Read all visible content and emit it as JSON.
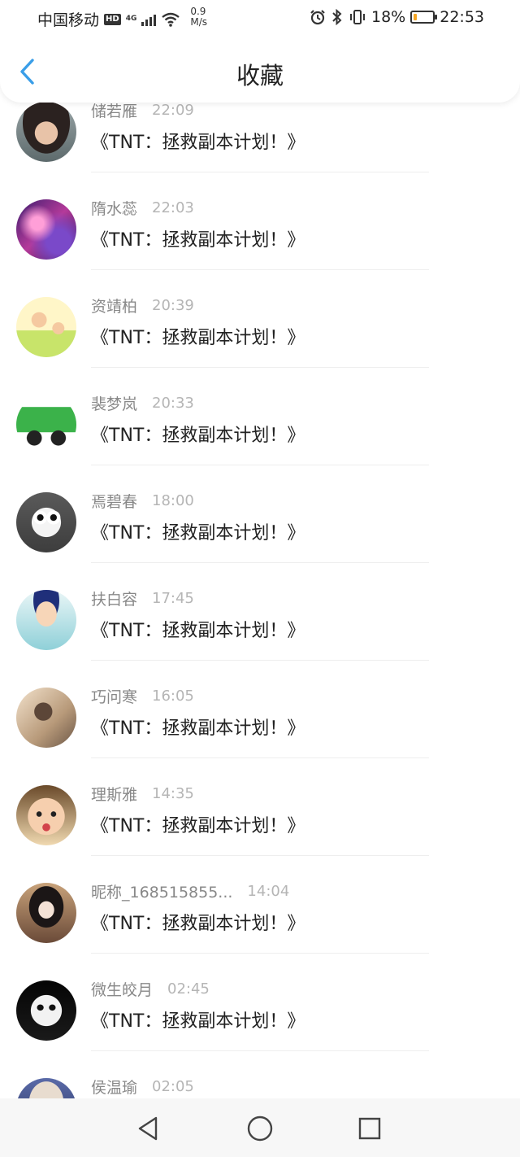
{
  "status_bar": {
    "carrier": "中国移动",
    "hd": "HD",
    "net_type": "4G",
    "speed_value": "0.9",
    "speed_unit": "M/s",
    "battery_percent": "18%",
    "battery_level": 0.18,
    "time": "22:53",
    "icons": [
      "alarm-icon",
      "bluetooth-icon",
      "vibrate-icon",
      "battery-icon"
    ]
  },
  "header": {
    "title": "收藏",
    "back_icon": "chevron-left-icon",
    "accent_color": "#3a9ee8"
  },
  "favorites": [
    {
      "name": "储若雁",
      "time": "22:09",
      "title": "《TNT：拯救副本计划！》",
      "avatar": "woman-portrait"
    },
    {
      "name": "隋水蕊",
      "time": "22:03",
      "title": "《TNT：拯救副本计划！》",
      "avatar": "purple-galaxy"
    },
    {
      "name": "资靖柏",
      "time": "20:39",
      "title": "《TNT：拯救副本计划！》",
      "avatar": "cartoon-kids"
    },
    {
      "name": "裴梦岚",
      "time": "20:33",
      "title": "《TNT：拯救副本计划！》",
      "avatar": "toy-truck"
    },
    {
      "name": "焉碧春",
      "time": "18:00",
      "title": "《TNT：拯救副本计划！》",
      "avatar": "cartoon-panda"
    },
    {
      "name": "扶白容",
      "time": "17:45",
      "title": "《TNT：拯救副本计划！》",
      "avatar": "cartoon-qing-official"
    },
    {
      "name": "巧问寒",
      "time": "16:05",
      "title": "《TNT：拯救副本计划！》",
      "avatar": "woman-field"
    },
    {
      "name": "理斯雅",
      "time": "14:35",
      "title": "《TNT：拯救副本计划！》",
      "avatar": "toddler-face"
    },
    {
      "name": "昵称_168515855...",
      "time": "14:04",
      "title": "《TNT：拯救副本计划！》",
      "avatar": "anime-girl"
    },
    {
      "name": "微生皎月",
      "time": "02:45",
      "title": "《TNT：拯救副本计划！》",
      "avatar": "white-mask"
    },
    {
      "name": "侯温瑜",
      "time": "02:05",
      "title": "",
      "avatar": "blonde-portrait"
    }
  ],
  "nav_bar": {
    "buttons": [
      "back-triangle-icon",
      "home-circle-icon",
      "recents-square-icon"
    ]
  }
}
